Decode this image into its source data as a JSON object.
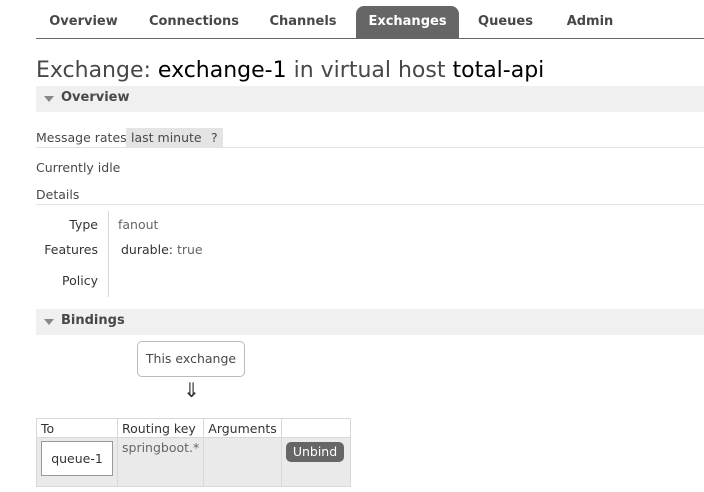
{
  "tabs": [
    {
      "label": "Overview"
    },
    {
      "label": "Connections"
    },
    {
      "label": "Channels"
    },
    {
      "label": "Exchanges"
    },
    {
      "label": "Queues"
    },
    {
      "label": "Admin"
    }
  ],
  "title": {
    "prefix": "Exchange:",
    "name": "exchange-1",
    "mid": "in virtual host",
    "vhost": "total-api"
  },
  "overview": {
    "header": "Overview",
    "message_rates_label": "Message rates",
    "message_rates_value": "last minute",
    "help": "?",
    "status": "Currently idle",
    "details_label": "Details",
    "type_label": "Type",
    "type_value": "fanout",
    "features_label": "Features",
    "features_key": "durable:",
    "features_value": "true",
    "policy_label": "Policy"
  },
  "bindings": {
    "header": "Bindings",
    "this_exchange": "This exchange",
    "arrow": "⇓",
    "columns": [
      "To",
      "Routing key",
      "Arguments",
      ""
    ],
    "rows": [
      {
        "to": "queue-1",
        "routing_key": "springboot.*",
        "arguments": "",
        "action": "Unbind"
      }
    ]
  },
  "colors": {
    "tab_active": "#666666",
    "section_bg": "#f0f0f0",
    "button": "#666666"
  }
}
